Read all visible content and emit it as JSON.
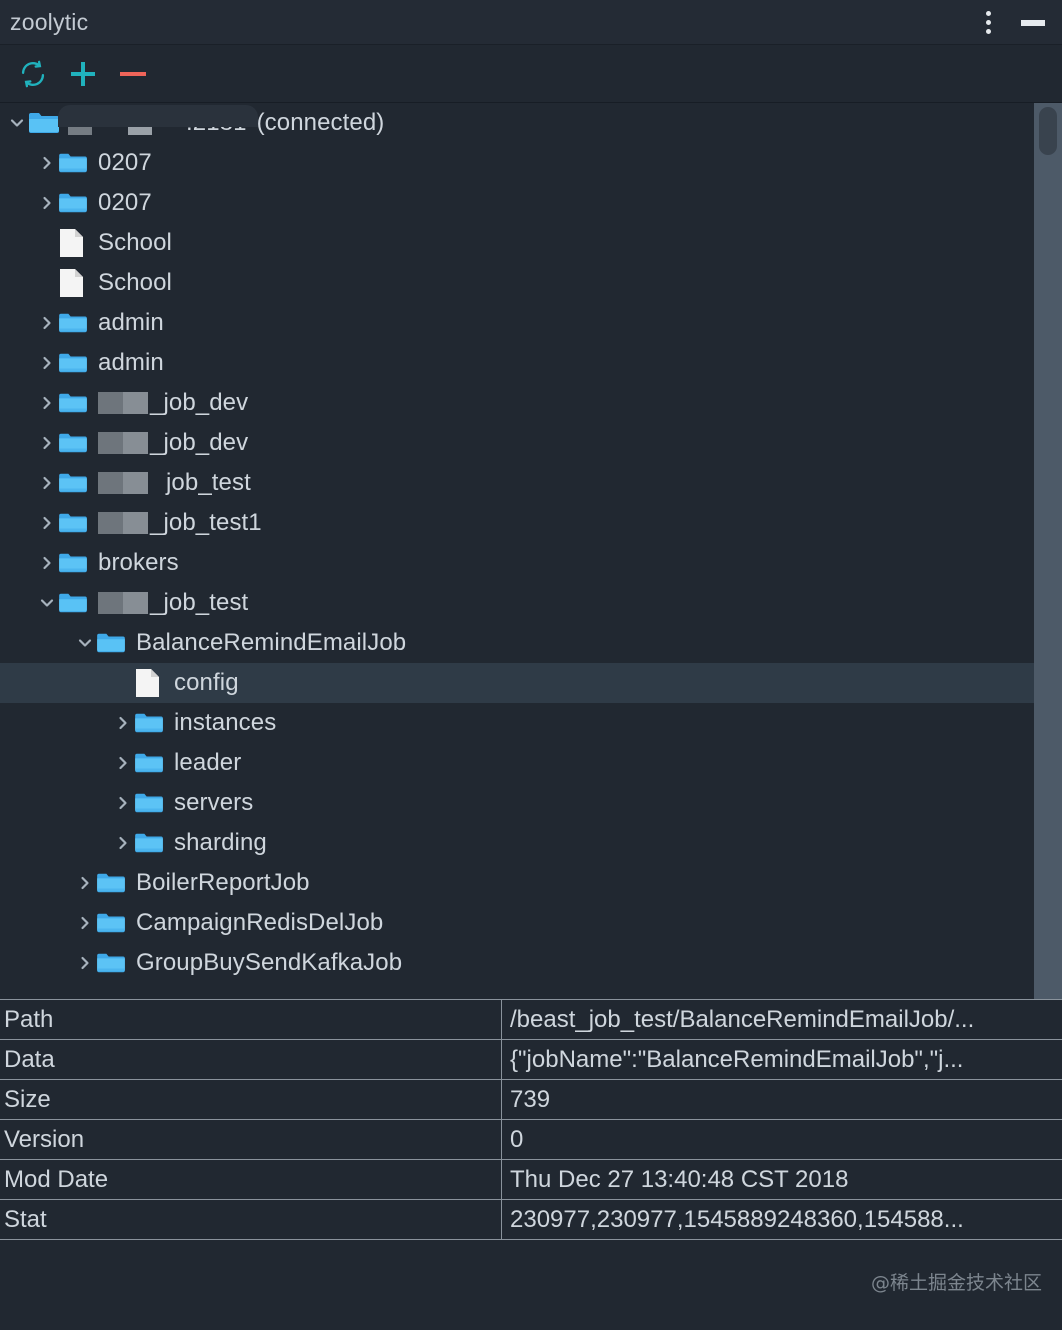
{
  "window": {
    "title": "zoolytic",
    "menu_icon": "kebab-menu-icon",
    "minimize_icon": "minimize-icon"
  },
  "toolbar": {
    "refresh_label": "Refresh",
    "add_label": "Add",
    "remove_label": "Remove",
    "refresh_color": "#20b2bd",
    "add_color": "#20b2bd",
    "remove_color": "#ef6459"
  },
  "tree": {
    "selected_row_color": "#2f3b47",
    "folder_color": "#4cb3ef",
    "root": {
      "port": ":2181",
      "status": "(connected)",
      "redacted": true
    },
    "nodes": [
      {
        "label": "0207",
        "type": "folder",
        "indent": 1,
        "expander": "collapsed"
      },
      {
        "label": "0207",
        "type": "folder",
        "indent": 1,
        "expander": "collapsed"
      },
      {
        "label": "School",
        "type": "file",
        "indent": 1,
        "expander": "none"
      },
      {
        "label": "School",
        "type": "file",
        "indent": 1,
        "expander": "none"
      },
      {
        "label": "admin",
        "type": "folder",
        "indent": 1,
        "expander": "collapsed"
      },
      {
        "label": "admin",
        "type": "folder",
        "indent": 1,
        "expander": "collapsed"
      },
      {
        "label": "_job_dev",
        "type": "folder",
        "indent": 1,
        "expander": "collapsed",
        "redacted_prefix": true
      },
      {
        "label": "_job_dev",
        "type": "folder",
        "indent": 1,
        "expander": "collapsed",
        "redacted_prefix": true
      },
      {
        "label": "job_test",
        "type": "folder",
        "indent": 1,
        "expander": "collapsed",
        "redacted_prefix": true
      },
      {
        "label": "_job_test1",
        "type": "folder",
        "indent": 1,
        "expander": "collapsed",
        "redacted_prefix": true
      },
      {
        "label": "brokers",
        "type": "folder",
        "indent": 1,
        "expander": "collapsed"
      },
      {
        "label": "_job_test",
        "type": "folder",
        "indent": 1,
        "expander": "expanded",
        "redacted_prefix": true
      },
      {
        "label": "BalanceRemindEmailJob",
        "type": "folder",
        "indent": 2,
        "expander": "expanded"
      },
      {
        "label": "config",
        "type": "file",
        "indent": 3,
        "expander": "none",
        "selected": true
      },
      {
        "label": "instances",
        "type": "folder",
        "indent": 3,
        "expander": "collapsed"
      },
      {
        "label": "leader",
        "type": "folder",
        "indent": 3,
        "expander": "collapsed"
      },
      {
        "label": "servers",
        "type": "folder",
        "indent": 3,
        "expander": "collapsed"
      },
      {
        "label": "sharding",
        "type": "folder",
        "indent": 3,
        "expander": "collapsed"
      },
      {
        "label": "BoilerReportJob",
        "type": "folder",
        "indent": 2,
        "expander": "collapsed"
      },
      {
        "label": "CampaignRedisDelJob",
        "type": "folder",
        "indent": 2,
        "expander": "collapsed"
      },
      {
        "label": "GroupBuySendKafkaJob",
        "type": "folder",
        "indent": 2,
        "expander": "collapsed"
      }
    ]
  },
  "details": {
    "rows": [
      {
        "key": "Path",
        "value": "/beast_job_test/BalanceRemindEmailJob/..."
      },
      {
        "key": "Data",
        "value": "{\"jobName\":\"BalanceRemindEmailJob\",\"j..."
      },
      {
        "key": "Size",
        "value": "739"
      },
      {
        "key": "Version",
        "value": "0"
      },
      {
        "key": "Mod Date",
        "value": "Thu Dec 27 13:40:48 CST 2018"
      },
      {
        "key": "Stat",
        "value": "230977,230977,1545889248360,154588..."
      }
    ]
  },
  "footer": {
    "watermark": "@稀土掘金技术社区"
  }
}
